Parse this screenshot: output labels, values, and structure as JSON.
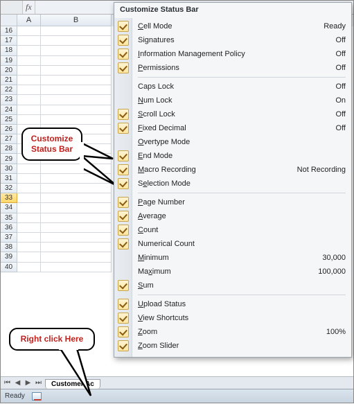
{
  "formula_bar": {
    "fx_label": "fx"
  },
  "columns": {
    "A": "A",
    "B": "B"
  },
  "row_start": 16,
  "row_end": 40,
  "selected_row": 33,
  "sheet_tab": {
    "name": "Customer Ac"
  },
  "status_bar": {
    "mode": "Ready"
  },
  "callouts": {
    "customize": "Customize Status Bar",
    "rightclick": "Right click Here"
  },
  "menu": {
    "title": "Customize Status Bar",
    "groups": [
      [
        {
          "checked": true,
          "label": "Cell Mode",
          "accel": "C",
          "value": "Ready"
        },
        {
          "checked": true,
          "label": "Signatures",
          "accel": "g",
          "value": "Off"
        },
        {
          "checked": true,
          "label": "Information Management Policy",
          "accel": "I",
          "value": "Off"
        },
        {
          "checked": true,
          "label": "Permissions",
          "accel": "P",
          "value": "Off"
        }
      ],
      [
        {
          "checked": false,
          "label": "Caps Lock",
          "accel": "",
          "value": "Off"
        },
        {
          "checked": false,
          "label": "Num Lock",
          "accel": "N",
          "value": "On"
        },
        {
          "checked": true,
          "label": "Scroll Lock",
          "accel": "S",
          "value": "Off"
        },
        {
          "checked": true,
          "label": "Fixed Decimal",
          "accel": "F",
          "value": "Off"
        },
        {
          "checked": false,
          "label": "Overtype Mode",
          "accel": "O",
          "value": ""
        },
        {
          "checked": true,
          "label": "End Mode",
          "accel": "E",
          "value": ""
        },
        {
          "checked": true,
          "label": "Macro Recording",
          "accel": "M",
          "value": "Not Recording"
        },
        {
          "checked": true,
          "label": "Selection Mode",
          "accel": "e",
          "value": ""
        }
      ],
      [
        {
          "checked": true,
          "label": "Page Number",
          "accel": "P",
          "value": ""
        },
        {
          "checked": true,
          "label": "Average",
          "accel": "A",
          "value": ""
        },
        {
          "checked": true,
          "label": "Count",
          "accel": "C",
          "value": ""
        },
        {
          "checked": true,
          "label": "Numerical Count",
          "accel": "",
          "value": ""
        },
        {
          "checked": false,
          "label": "Minimum",
          "accel": "M",
          "value": "30,000"
        },
        {
          "checked": false,
          "label": "Maximum",
          "accel": "x",
          "value": "100,000"
        },
        {
          "checked": true,
          "label": "Sum",
          "accel": "S",
          "value": ""
        }
      ],
      [
        {
          "checked": true,
          "label": "Upload Status",
          "accel": "U",
          "value": ""
        },
        {
          "checked": true,
          "label": "View Shortcuts",
          "accel": "V",
          "value": ""
        },
        {
          "checked": true,
          "label": "Zoom",
          "accel": "Z",
          "value": "100%"
        },
        {
          "checked": true,
          "label": "Zoom Slider",
          "accel": "Z",
          "value": ""
        }
      ]
    ]
  }
}
